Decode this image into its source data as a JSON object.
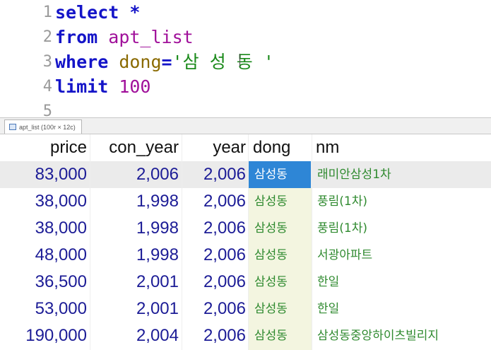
{
  "editor": {
    "lines": [
      {
        "n": "1",
        "tokens": [
          {
            "t": "select",
            "c": "kw"
          },
          {
            "t": " ",
            "c": ""
          },
          {
            "t": "*",
            "c": "op"
          }
        ]
      },
      {
        "n": "2",
        "tokens": [
          {
            "t": "from",
            "c": "kw"
          },
          {
            "t": " ",
            "c": ""
          },
          {
            "t": "apt_list",
            "c": "id"
          }
        ]
      },
      {
        "n": "3",
        "tokens": [
          {
            "t": "where",
            "c": "kw"
          },
          {
            "t": " ",
            "c": ""
          },
          {
            "t": "dong",
            "c": "col"
          },
          {
            "t": "=",
            "c": "op"
          },
          {
            "t": "'삼 성 동 '",
            "c": "str"
          }
        ]
      },
      {
        "n": "4",
        "tokens": [
          {
            "t": "limit",
            "c": "kw"
          },
          {
            "t": " ",
            "c": ""
          },
          {
            "t": "100",
            "c": "num"
          }
        ]
      },
      {
        "n": "5",
        "tokens": []
      }
    ]
  },
  "result_tab": {
    "label": "apt_list (100r × 12c)"
  },
  "table": {
    "columns": [
      "price",
      "con_year",
      "year",
      "dong",
      "nm"
    ],
    "rows": [
      [
        "83,000",
        "2,006",
        "2,006",
        "삼성동",
        "래미안삼성1차"
      ],
      [
        "38,000",
        "1,998",
        "2,006",
        "삼성동",
        "풍림(1차)"
      ],
      [
        "38,000",
        "1,998",
        "2,006",
        "삼성동",
        "풍림(1차)"
      ],
      [
        "48,000",
        "1,998",
        "2,006",
        "삼성동",
        "서광아파트"
      ],
      [
        "36,500",
        "2,001",
        "2,006",
        "삼성동",
        "한일"
      ],
      [
        "53,000",
        "2,001",
        "2,006",
        "삼성동",
        "한일"
      ],
      [
        "190,000",
        "2,004",
        "2,006",
        "삼성동",
        "삼성동중앙하이츠빌리지"
      ]
    ]
  }
}
